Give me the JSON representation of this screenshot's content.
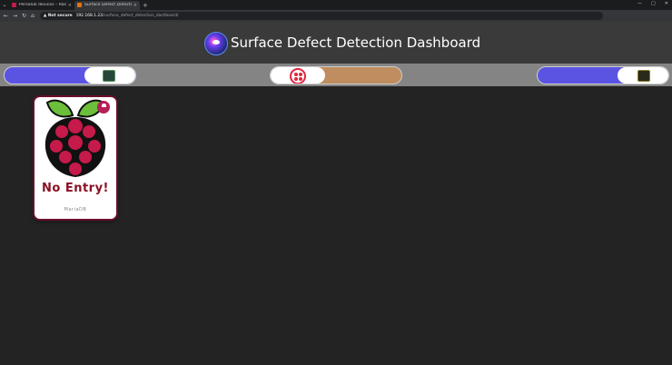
{
  "browser": {
    "tabs": [
      {
        "label": "Personal devices – Raspberry P",
        "favicon_color": "#c51a4a"
      },
      {
        "label": "Surface Defect Detection Dash",
        "favicon_color": "#e8710a"
      }
    ],
    "new_tab_label": "+",
    "security_label": "Not secure",
    "url_host": "192.168.1.23",
    "url_path": "/surface_defect_detection_dashboard/"
  },
  "header": {
    "title": "Surface Defect Detection Dashboard"
  },
  "strip": {
    "accent_color": "#5b54e3",
    "twilio_color": "#bf8d5f"
  },
  "card": {
    "status_text": "No Entry!",
    "database_label": "MariaDB"
  }
}
